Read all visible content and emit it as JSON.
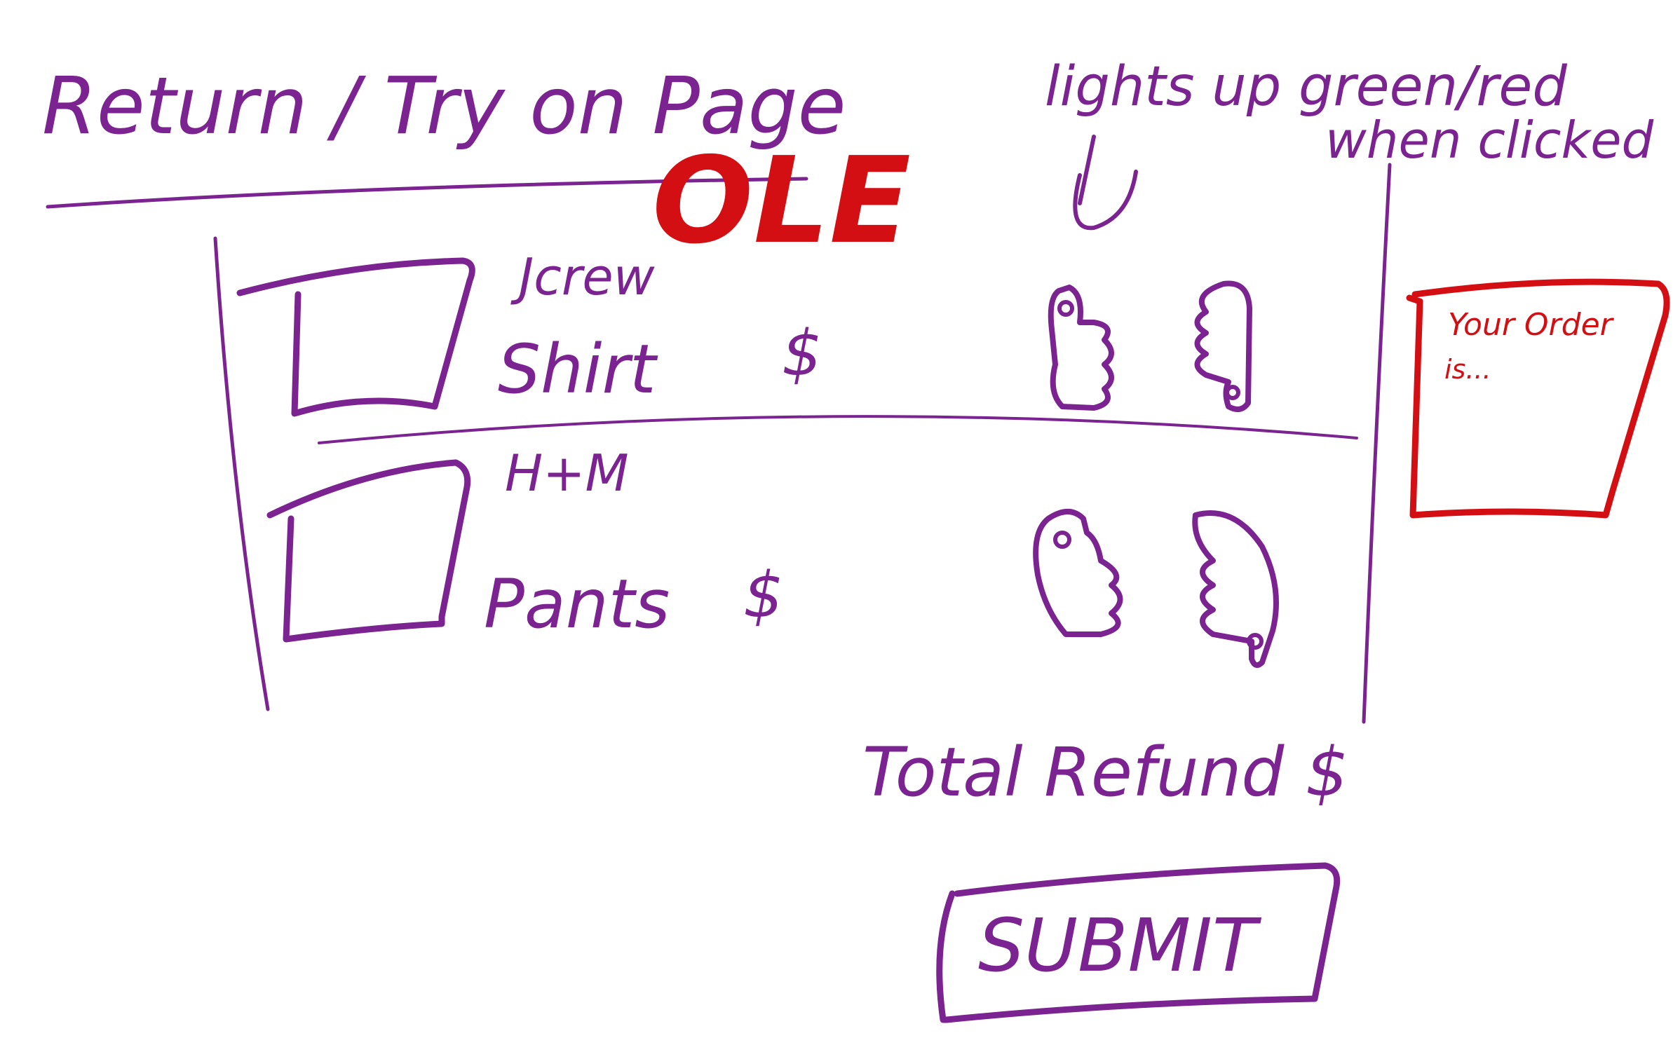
{
  "colors": {
    "ink": "#7b2390",
    "accent": "#d40f14",
    "background": "#ffffff"
  },
  "page": {
    "title": "Return / Try on Page",
    "logo": "OLE",
    "notes": {
      "line1": "lights up green/red",
      "line2": "when clicked"
    }
  },
  "items": [
    {
      "brand": "Jcrew",
      "name": "Shirt",
      "price": "$",
      "buttons": [
        "thumbs-up-icon",
        "thumbs-down-icon"
      ]
    },
    {
      "brand": "H+M",
      "name": "Pants",
      "price": "$",
      "buttons": [
        "thumbs-up-icon",
        "thumbs-down-icon"
      ]
    }
  ],
  "side_panel": {
    "text_line1": "Your Order",
    "text_line2": "is..."
  },
  "total": {
    "label": "Total Refund $"
  },
  "submit": {
    "label": "SUBMIT"
  }
}
